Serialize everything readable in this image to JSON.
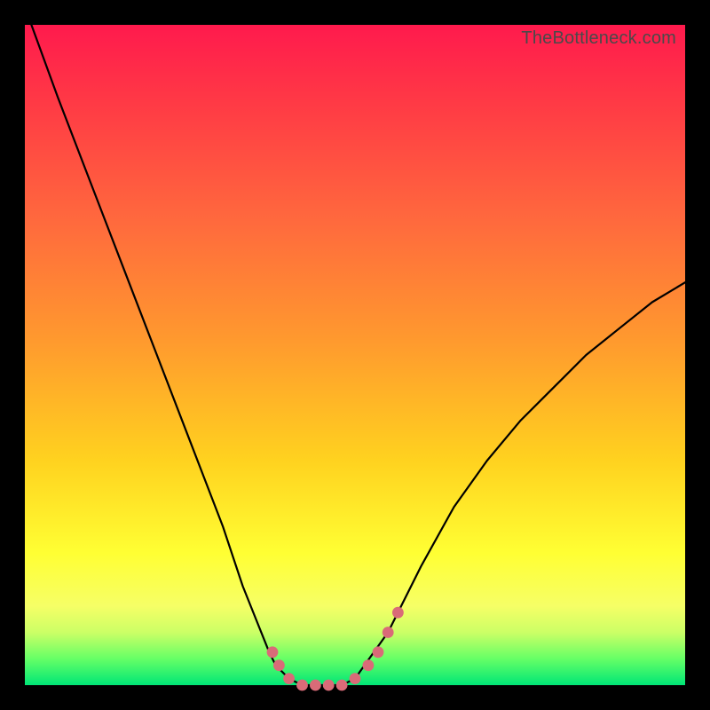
{
  "watermark": "TheBottleneck.com",
  "chart_data": {
    "type": "line",
    "title": "",
    "xlabel": "",
    "ylabel": "",
    "xlim": [
      0,
      100
    ],
    "ylim": [
      0,
      100
    ],
    "grid": false,
    "legend": false,
    "series": [
      {
        "name": "bottleneck-curve",
        "x": [
          1,
          5,
          10,
          15,
          20,
          25,
          30,
          33,
          35,
          37,
          38,
          40,
          42,
          44,
          46,
          48,
          50,
          55,
          60,
          65,
          70,
          75,
          80,
          85,
          90,
          95,
          100
        ],
        "y": [
          100,
          89,
          76,
          63,
          50,
          37,
          24,
          15,
          10,
          5,
          3,
          1,
          0,
          0,
          0,
          0,
          1,
          8,
          18,
          27,
          34,
          40,
          45,
          50,
          54,
          58,
          61
        ]
      }
    ],
    "markers": {
      "name": "highlight-dots",
      "x": [
        37.5,
        38.5,
        40,
        42,
        44,
        46,
        48,
        50,
        52,
        53.5,
        55,
        56.5
      ],
      "y": [
        5,
        3,
        1,
        0,
        0,
        0,
        0,
        1,
        3,
        5,
        8,
        11
      ],
      "r": [
        4,
        4,
        4,
        4,
        4,
        4,
        4,
        4,
        4,
        4,
        4,
        4
      ]
    },
    "gradient_stops": [
      {
        "pos": 0,
        "color": "#ff1a4d"
      },
      {
        "pos": 30,
        "color": "#ff6a3d"
      },
      {
        "pos": 66,
        "color": "#ffd21f"
      },
      {
        "pos": 88,
        "color": "#f6ff66"
      },
      {
        "pos": 100,
        "color": "#00e676"
      }
    ]
  }
}
